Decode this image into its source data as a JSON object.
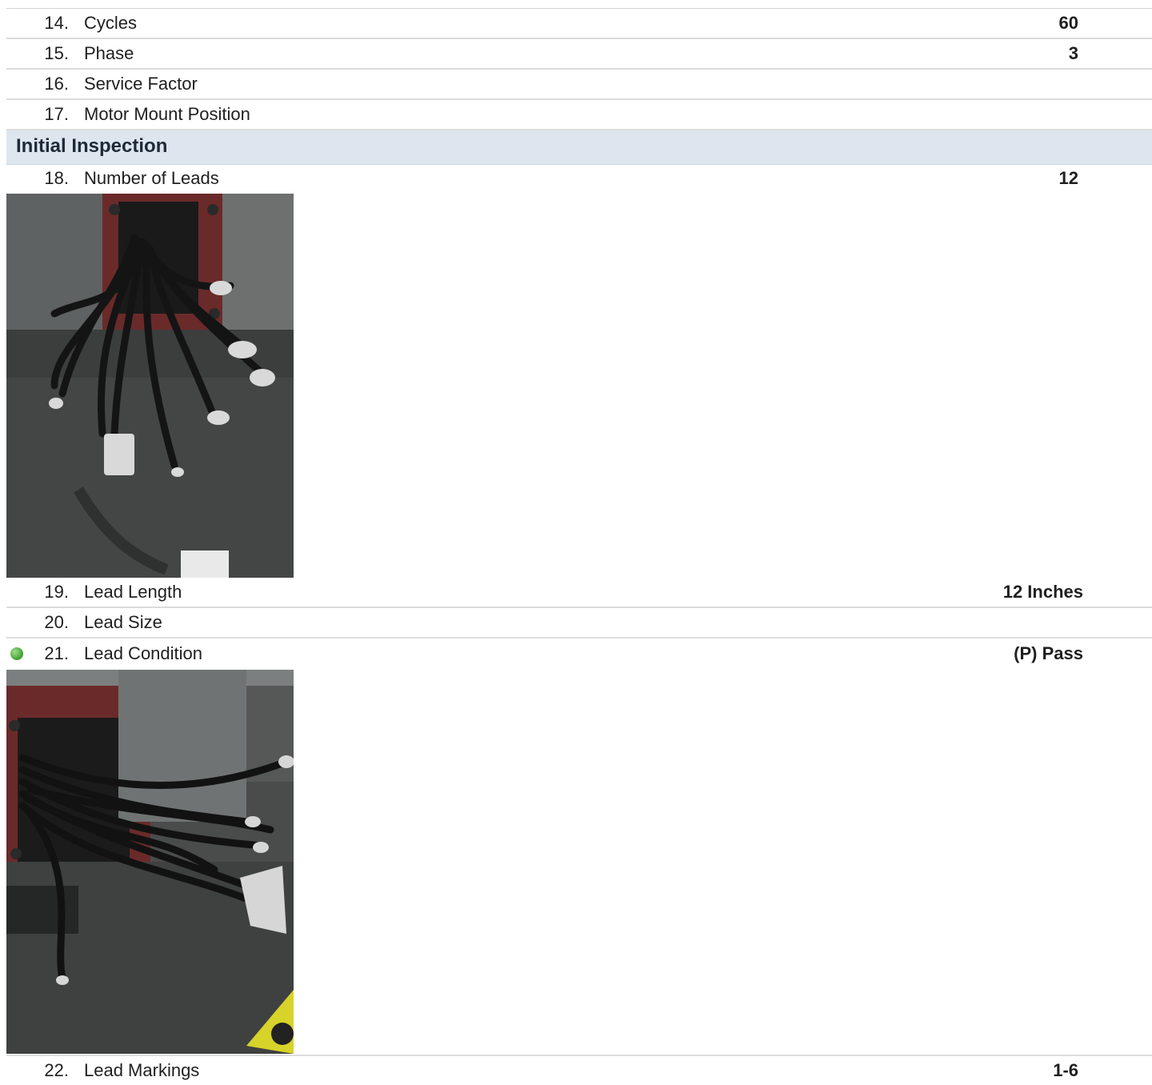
{
  "rows_top": [
    {
      "number": "14.",
      "label": "Cycles",
      "value": "60"
    },
    {
      "number": "15.",
      "label": "Phase",
      "value": "3"
    },
    {
      "number": "16.",
      "label": "Service Factor",
      "value": ""
    },
    {
      "number": "17.",
      "label": "Motor Mount Position",
      "value": ""
    }
  ],
  "section": {
    "title": "Initial Inspection"
  },
  "row_18": {
    "number": "18.",
    "label": "Number of Leads",
    "value": "12"
  },
  "row_19": {
    "number": "19.",
    "label": "Lead Length",
    "value": "12 Inches"
  },
  "row_20": {
    "number": "20.",
    "label": "Lead Size",
    "value": ""
  },
  "row_21": {
    "number": "21.",
    "label": "Lead Condition",
    "value": "(P) Pass",
    "status_color": "#4caf3a"
  },
  "row_22": {
    "number": "22.",
    "label": "Lead Markings",
    "value": "1-6"
  }
}
